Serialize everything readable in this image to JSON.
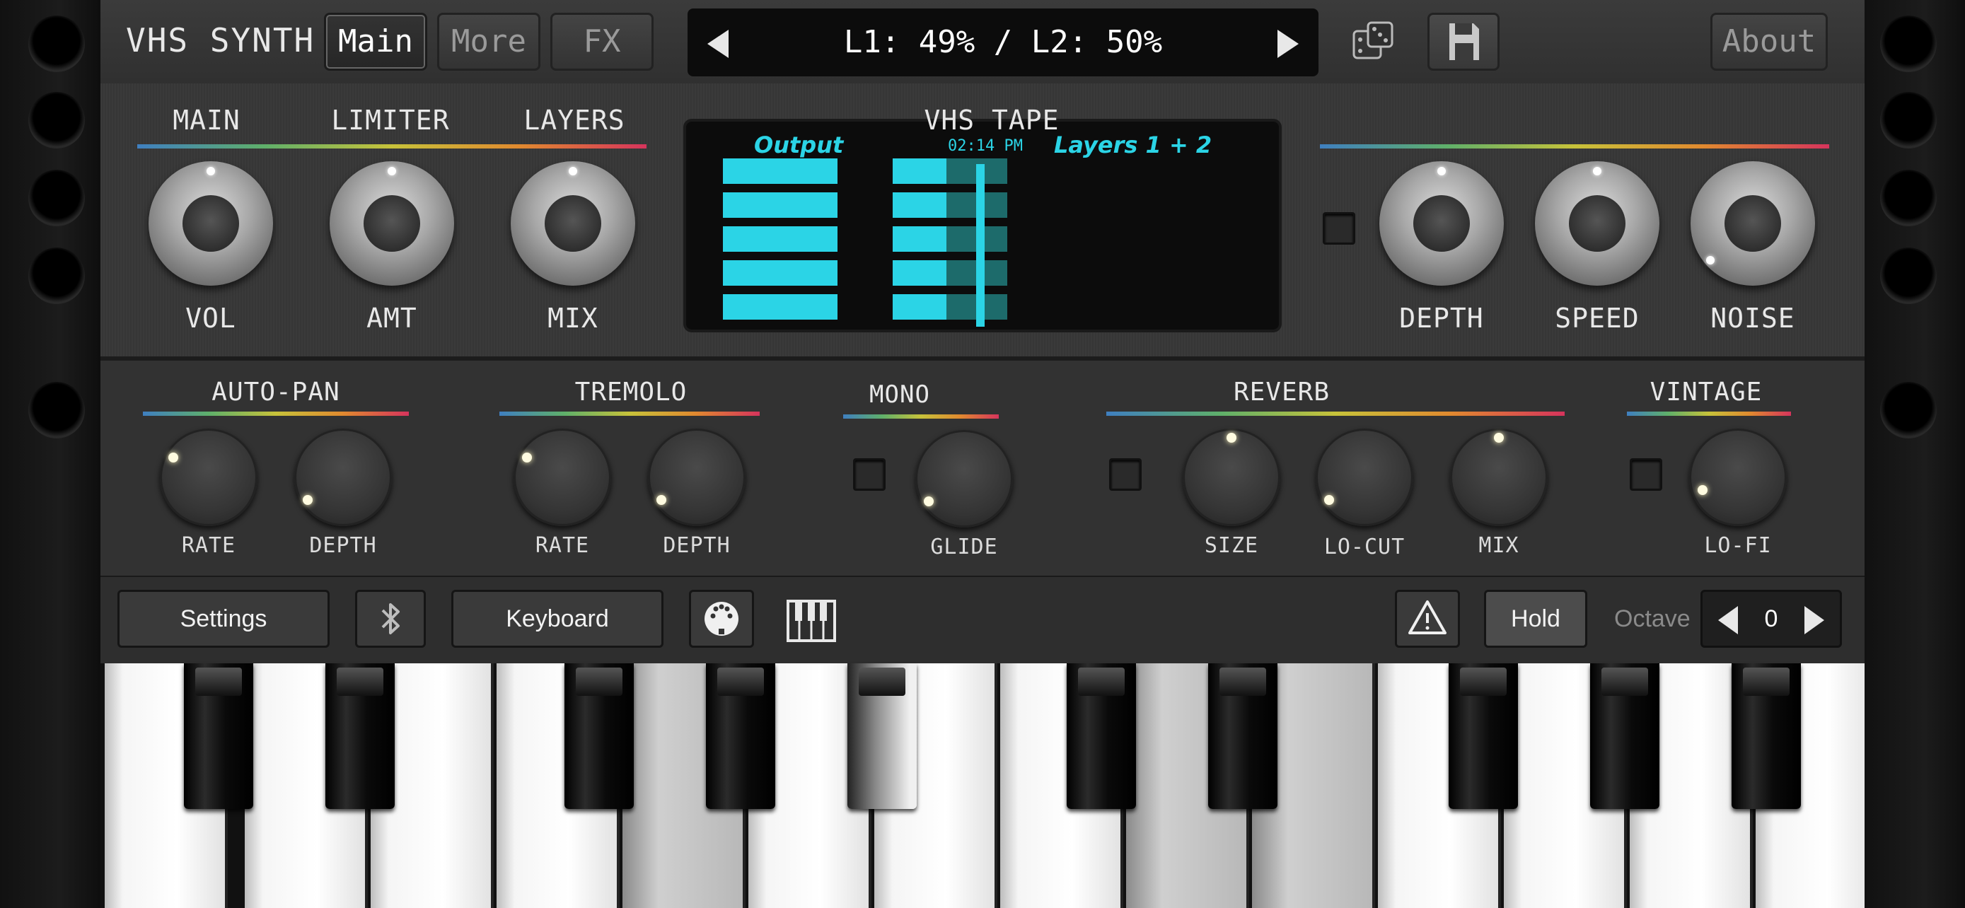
{
  "header": {
    "app_title": "VHS SYNTH",
    "tabs": [
      {
        "label": "Main"
      },
      {
        "label": "More"
      },
      {
        "label": "FX"
      }
    ],
    "active_tab": "Main",
    "preset_display": "L1: 49% / L2: 50%",
    "about_label": "About"
  },
  "panel1": {
    "group_labels": {
      "main": "MAIN",
      "limiter": "LIMITER",
      "layers": "LAYERS",
      "vhs_tape": "VHS TAPE"
    },
    "knobs": {
      "vol": "VOL",
      "amt": "AMT",
      "mix": "MIX",
      "depth": "DEPTH",
      "speed": "SPEED",
      "noise": "NOISE"
    },
    "meter": {
      "output_label": "Output",
      "layers_label": "Layers 1 + 2",
      "clock": "02:14 PM",
      "accent_color": "#2bd4e6",
      "dim_color": "#1d6b6b"
    }
  },
  "panel2": {
    "group_labels": {
      "auto_pan": "AUTO-PAN",
      "tremolo": "TREMOLO",
      "mono": "MONO",
      "reverb": "REVERB",
      "vintage": "VINTAGE"
    },
    "knobs": {
      "autopan_rate": "RATE",
      "autopan_depth": "DEPTH",
      "tremolo_rate": "RATE",
      "tremolo_depth": "DEPTH",
      "glide": "GLIDE",
      "size": "SIZE",
      "locut": "LO-CUT",
      "reverb_mix": "MIX",
      "lofi": "LO-FI"
    }
  },
  "toolbar": {
    "settings_label": "Settings",
    "keyboard_label": "Keyboard",
    "hold_label": "Hold",
    "octave_label": "Octave",
    "octave_value": "0"
  },
  "icons": [
    "dice-icon",
    "save-icon",
    "bluetooth-icon",
    "midi-icon",
    "piano-icon",
    "warning-icon",
    "arrow-left-icon",
    "arrow-right-icon"
  ]
}
